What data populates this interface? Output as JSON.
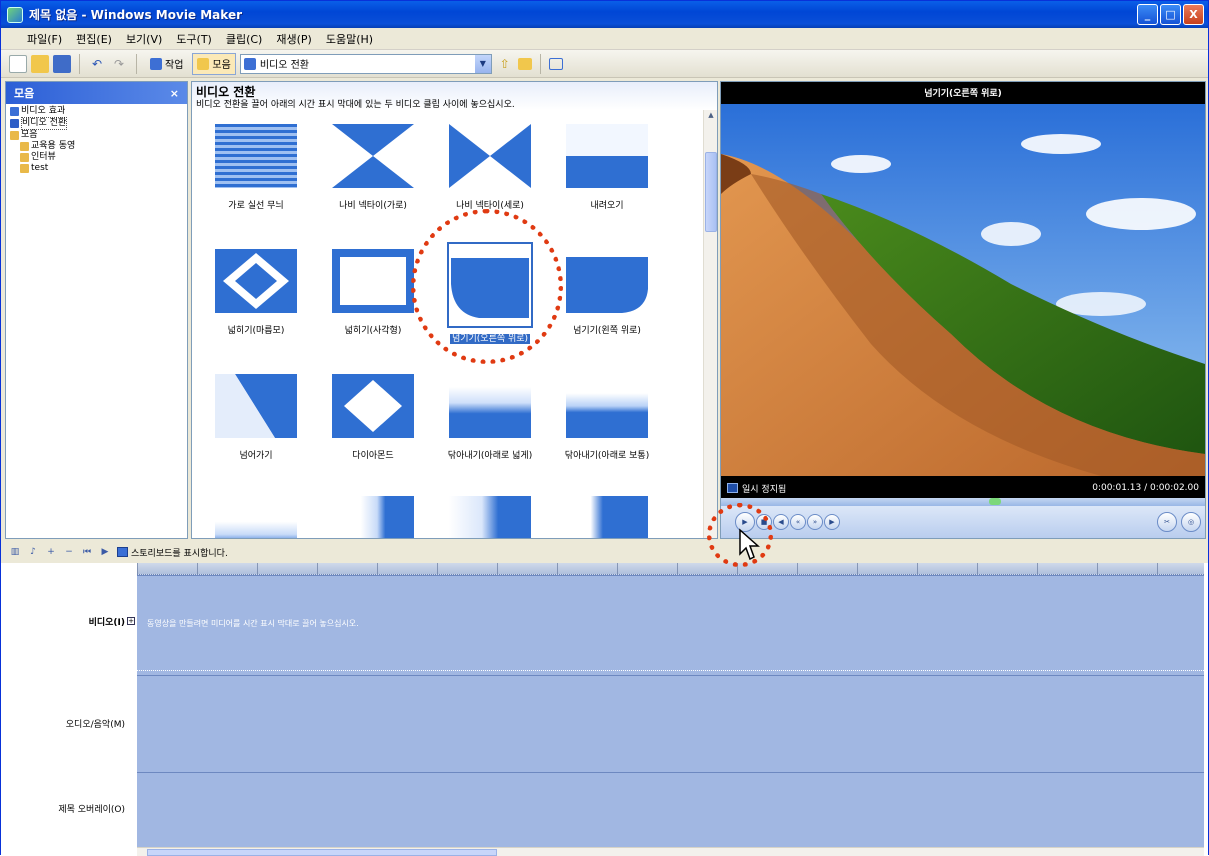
{
  "window": {
    "title": "제목 없음 - Windows Movie Maker",
    "buttons": [
      "_",
      "□",
      "X"
    ]
  },
  "menu": [
    "파일(F)",
    "편집(E)",
    "보기(V)",
    "도구(T)",
    "클립(C)",
    "재생(P)",
    "도움말(H)"
  ],
  "toolbar": {
    "tasks_label": "작업",
    "collections_label": "모음",
    "combo_value": "비디오 전환"
  },
  "collections": {
    "header": "모음",
    "items": [
      {
        "label": "비디오 효과",
        "level": 0
      },
      {
        "label": "비디오 전환",
        "level": 0,
        "selected": true
      },
      {
        "label": "모음",
        "level": 0
      },
      {
        "label": "교육용 동영",
        "level": 1
      },
      {
        "label": "인터뷰",
        "level": 1
      },
      {
        "label": "test",
        "level": 1
      }
    ]
  },
  "content": {
    "title": "비디오 전환",
    "description": "비디오 전환을 끌어 아래의 시간 표시 막대에 있는 두 비디오 클립 사이에 놓으십시오.",
    "tiles": [
      {
        "label": "가로 실선 무늬",
        "icon": "blinds-horizontal"
      },
      {
        "label": "나비 넥타이(가로)",
        "icon": "bowtie-horizontal"
      },
      {
        "label": "나비 넥타이(세로)",
        "icon": "bowtie-vertical"
      },
      {
        "label": "내려오기",
        "icon": "bar-down"
      },
      {
        "label": "넓히기(마름모)",
        "icon": "diamond-expand"
      },
      {
        "label": "넓히기(사각형)",
        "icon": "rect-expand"
      },
      {
        "label": "넘기기(오른쪽 위로)",
        "icon": "page-curl-right",
        "selected": true
      },
      {
        "label": "넘기기(왼쪽 위로)",
        "icon": "page-curl-left"
      },
      {
        "label": "넘어가기",
        "icon": "diagonal-wipe"
      },
      {
        "label": "다이아몬드",
        "icon": "diamond"
      },
      {
        "label": "닦아내기(아래로 넓게)",
        "icon": "fade-down-wide"
      },
      {
        "label": "닦아내기(아래로 보통)",
        "icon": "fade-down-normal"
      },
      {
        "label": "",
        "icon": "fade-bottom"
      },
      {
        "label": "",
        "icon": "fade-right"
      },
      {
        "label": "",
        "icon": "fade-right-2"
      },
      {
        "label": "",
        "icon": "fade-right-3"
      }
    ]
  },
  "preview": {
    "title": "넘기기(오른쪽 위로)",
    "status": "일시 정지됨",
    "time": "0:00:01.13 / 0:00:02.00"
  },
  "timeline": {
    "storyboard_button": "스토리보드를 표시합니다.",
    "tracks": {
      "video": "비디오(I)",
      "audio": "오디오/음악(M)",
      "title": "제목 오버레이(O)"
    },
    "video_hint": "동영상을 만들려면 미디어를 시간 표시 막대로 끌어 놓으십시오."
  },
  "colors": {
    "accent": "#316ac5",
    "track": "#a1b7e2",
    "annotation": "#e03a12"
  }
}
